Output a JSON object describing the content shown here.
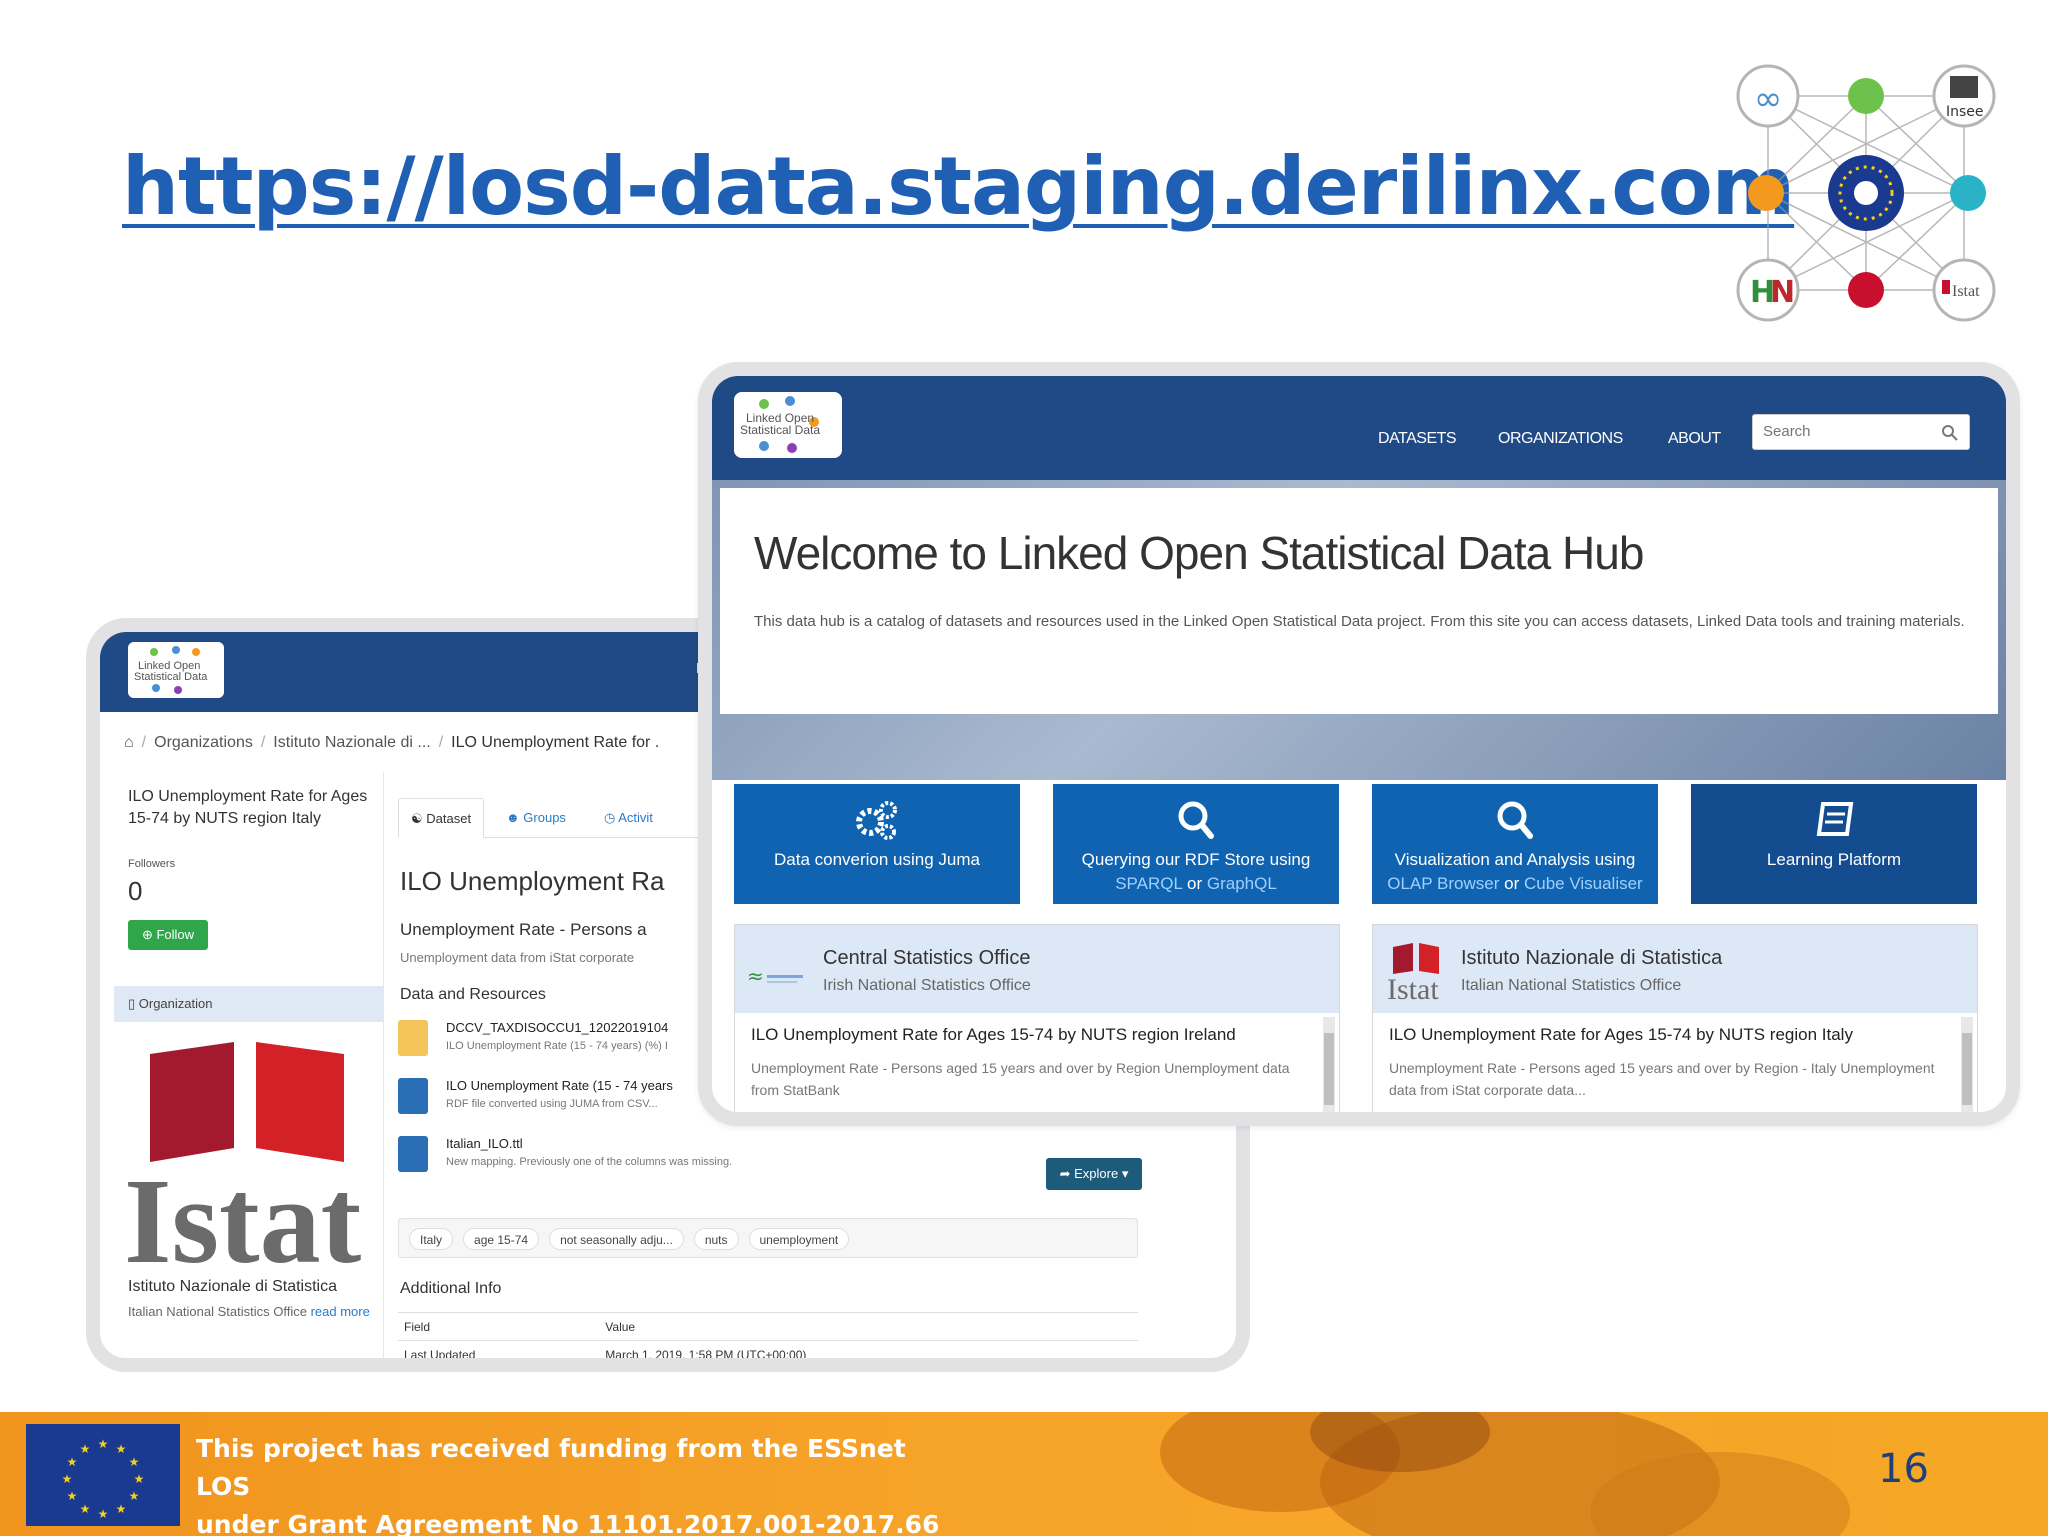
{
  "slide": {
    "url": "https://losd-data.staging.derilinx.com",
    "page_number": "16"
  },
  "network_logo": {
    "insee": "Insee",
    "istat": "Istat"
  },
  "back_screen": {
    "logo_text": [
      "Linked Open",
      "Statistical Data"
    ],
    "nav_cut": "D",
    "breadcrumb": {
      "organizations": "Organizations",
      "org": "Istituto Nazionale di ...",
      "dataset": "ILO Unemployment Rate for ."
    },
    "sidebar": {
      "title": "ILO Unemployment Rate for Ages 15-74 by NUTS region Italy",
      "followers_label": "Followers",
      "followers_count": "0",
      "follow_label": "Follow",
      "organization_label": "Organization",
      "org_name": "Istituto Nazionale di Statistica",
      "org_desc": "Italian National Statistics Office",
      "read_more": "read more",
      "logo_text": "Istat"
    },
    "tabs": [
      "Dataset",
      "Groups",
      "Activit"
    ],
    "heading": "ILO Unemployment Ra",
    "subheading": "Unemployment Rate - Persons a",
    "description": "Unemployment data from iStat corporate",
    "resources_title": "Data and Resources",
    "resources": [
      {
        "name": "DCCV_TAXDISOCCU1_12022019104",
        "desc": "ILO Unemployment Rate (15 - 74 years) (%) I"
      },
      {
        "name": "ILO Unemployment Rate (15 - 74 years",
        "desc": "RDF file converted using JUMA from CSV..."
      },
      {
        "name": "Italian_ILO.ttl",
        "desc": "New mapping. Previously one of the columns was missing."
      }
    ],
    "explore_label": "Explore",
    "tags": [
      "Italy",
      "age 15-74",
      "not seasonally adju...",
      "nuts",
      "unemployment"
    ],
    "additional_title": "Additional Info",
    "table": {
      "headers": [
        "Field",
        "Value"
      ],
      "rows": [
        [
          "Last Updated",
          "March 1, 2019, 1:58 PM (UTC+00:00)"
        ]
      ]
    }
  },
  "front_screen": {
    "logo_text": [
      "Linked Open",
      "Statistical Data"
    ],
    "nav": [
      "DATASETS",
      "ORGANIZATIONS",
      "ABOUT"
    ],
    "search_placeholder": "Search",
    "welcome_title": "Welcome to Linked Open Statistical Data Hub",
    "welcome_text": "This data hub is a catalog of datasets and resources used in the Linked Open Statistical Data project. From this site you can access datasets, Linked Data tools and training materials.",
    "tiles": [
      {
        "line1": "Data converion using Juma",
        "line2a": "",
        "or": "",
        "line2b": ""
      },
      {
        "line1": "Querying our RDF Store using",
        "line2a": "SPARQL",
        "or": "or",
        "line2b": "GraphQL"
      },
      {
        "line1": "Visualization and Analysis using",
        "line2a": "OLAP Browser",
        "or": "or",
        "line2b": "Cube Visualiser"
      },
      {
        "line1": "Learning Platform",
        "line2a": "",
        "or": "",
        "line2b": ""
      }
    ],
    "orgs": [
      {
        "name": "Central Statistics Office",
        "subtitle": "Irish National Statistics Office",
        "dataset_title": "ILO Unemployment Rate for Ages 15-74 by NUTS region Ireland",
        "dataset_desc": "Unemployment Rate - Persons aged 15 years and over by Region Unemployment data from StatBank"
      },
      {
        "name": "Istituto Nazionale di Statistica",
        "subtitle": "Italian National Statistics Office",
        "dataset_title": "ILO Unemployment Rate for Ages 15-74 by NUTS region Italy",
        "dataset_desc": "Unemployment Rate - Persons aged 15 years and over by Region - Italy Unemployment data from iStat corporate data..."
      }
    ]
  },
  "footer": {
    "line1": "This project has received funding from the ESSnet LOS",
    "line2": "under Grant Agreement No 11101.2017.001-2017.66"
  },
  "colors": {
    "title_blue": "#1f5fb4",
    "nav_blue": "#1f4a86",
    "tile_blue": "#0f63b0",
    "footer_orange": "#f7a52a"
  }
}
